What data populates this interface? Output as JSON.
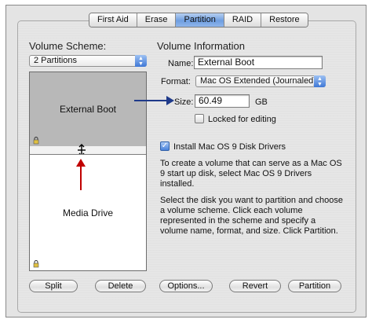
{
  "tabs": [
    {
      "label": "First Aid",
      "active": false
    },
    {
      "label": "Erase",
      "active": false
    },
    {
      "label": "Partition",
      "active": true
    },
    {
      "label": "RAID",
      "active": false
    },
    {
      "label": "Restore",
      "active": false
    }
  ],
  "volume_scheme": {
    "heading": "Volume Scheme:",
    "selected": "2 Partitions",
    "partitions": [
      {
        "name": "External Boot",
        "selected": true
      },
      {
        "name": "Media Drive",
        "selected": false
      }
    ]
  },
  "volume_info": {
    "heading": "Volume Information",
    "name_label": "Name:",
    "name_value": "External Boot",
    "format_label": "Format:",
    "format_value": "Mac OS Extended (Journaled)",
    "size_label": "Size:",
    "size_value": "60.49",
    "size_unit": "GB",
    "locked_label": "Locked for editing",
    "locked_checked": false,
    "install_label": "Install Mac OS 9 Disk Drivers",
    "install_checked": true,
    "install_help": "To create a volume that can serve as a Mac OS 9 start up disk, select Mac OS 9 Drivers installed.",
    "instructions": "Select the disk you want to partition and choose a volume scheme. Click each volume represented in the scheme and specify a volume name, format, and size. Click Partition."
  },
  "buttons": {
    "split": "Split",
    "delete": "Delete",
    "options": "Options...",
    "revert": "Revert",
    "partition": "Partition"
  },
  "colors": {
    "annotation_blue": "#1f3a8a",
    "annotation_red": "#c00000",
    "selected_tab": "#6e9ee0"
  }
}
